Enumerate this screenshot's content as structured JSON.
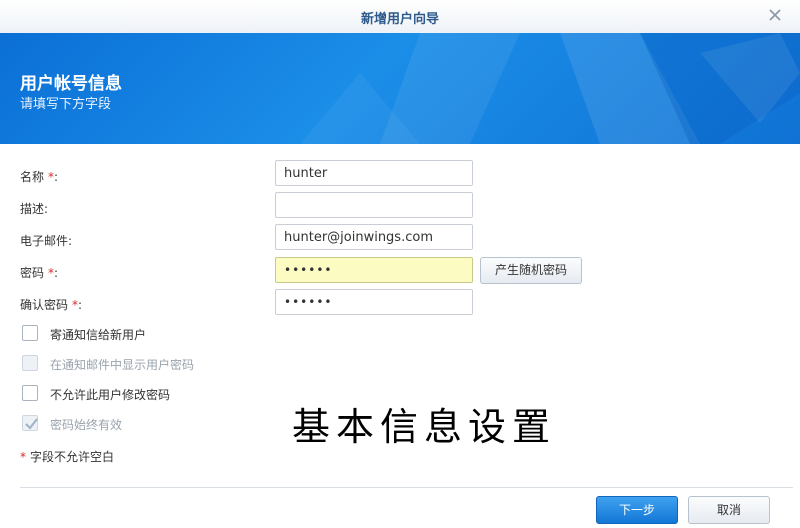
{
  "window": {
    "title": "新增用户向导"
  },
  "banner": {
    "heading": "用户帐号信息",
    "subheading": "请填写下方字段"
  },
  "form": {
    "name_label": "名称",
    "name_required": "*",
    "name_colon": ":",
    "name_value": "hunter",
    "desc_label": "描述:",
    "desc_value": "",
    "email_label": "电子邮件:",
    "email_value": "hunter@joinwings.com",
    "password_label": "密码",
    "password_required": "*",
    "password_colon": ":",
    "password_mask": "••••••",
    "generate_password_label": "产生随机密码",
    "confirm_label": "确认密码",
    "confirm_required": "*",
    "confirm_colon": ":",
    "confirm_mask": "••••••"
  },
  "options": [
    {
      "label": "寄通知信给新用户",
      "checked": false,
      "disabled": false
    },
    {
      "label": "在通知邮件中显示用户密码",
      "checked": false,
      "disabled": true
    },
    {
      "label": "不允许此用户修改密码",
      "checked": false,
      "disabled": false
    },
    {
      "label": "密码始终有效",
      "checked": true,
      "disabled": true
    }
  ],
  "note": {
    "star": "*",
    "text": "字段不允许空白"
  },
  "annotation": {
    "text": "基本信息设置"
  },
  "footer": {
    "next_label": "下一步",
    "cancel_label": "取消"
  },
  "colors": {
    "accent": "#1a86e3",
    "required": "#d62c2c",
    "password_highlight": "#fbfbc2"
  }
}
